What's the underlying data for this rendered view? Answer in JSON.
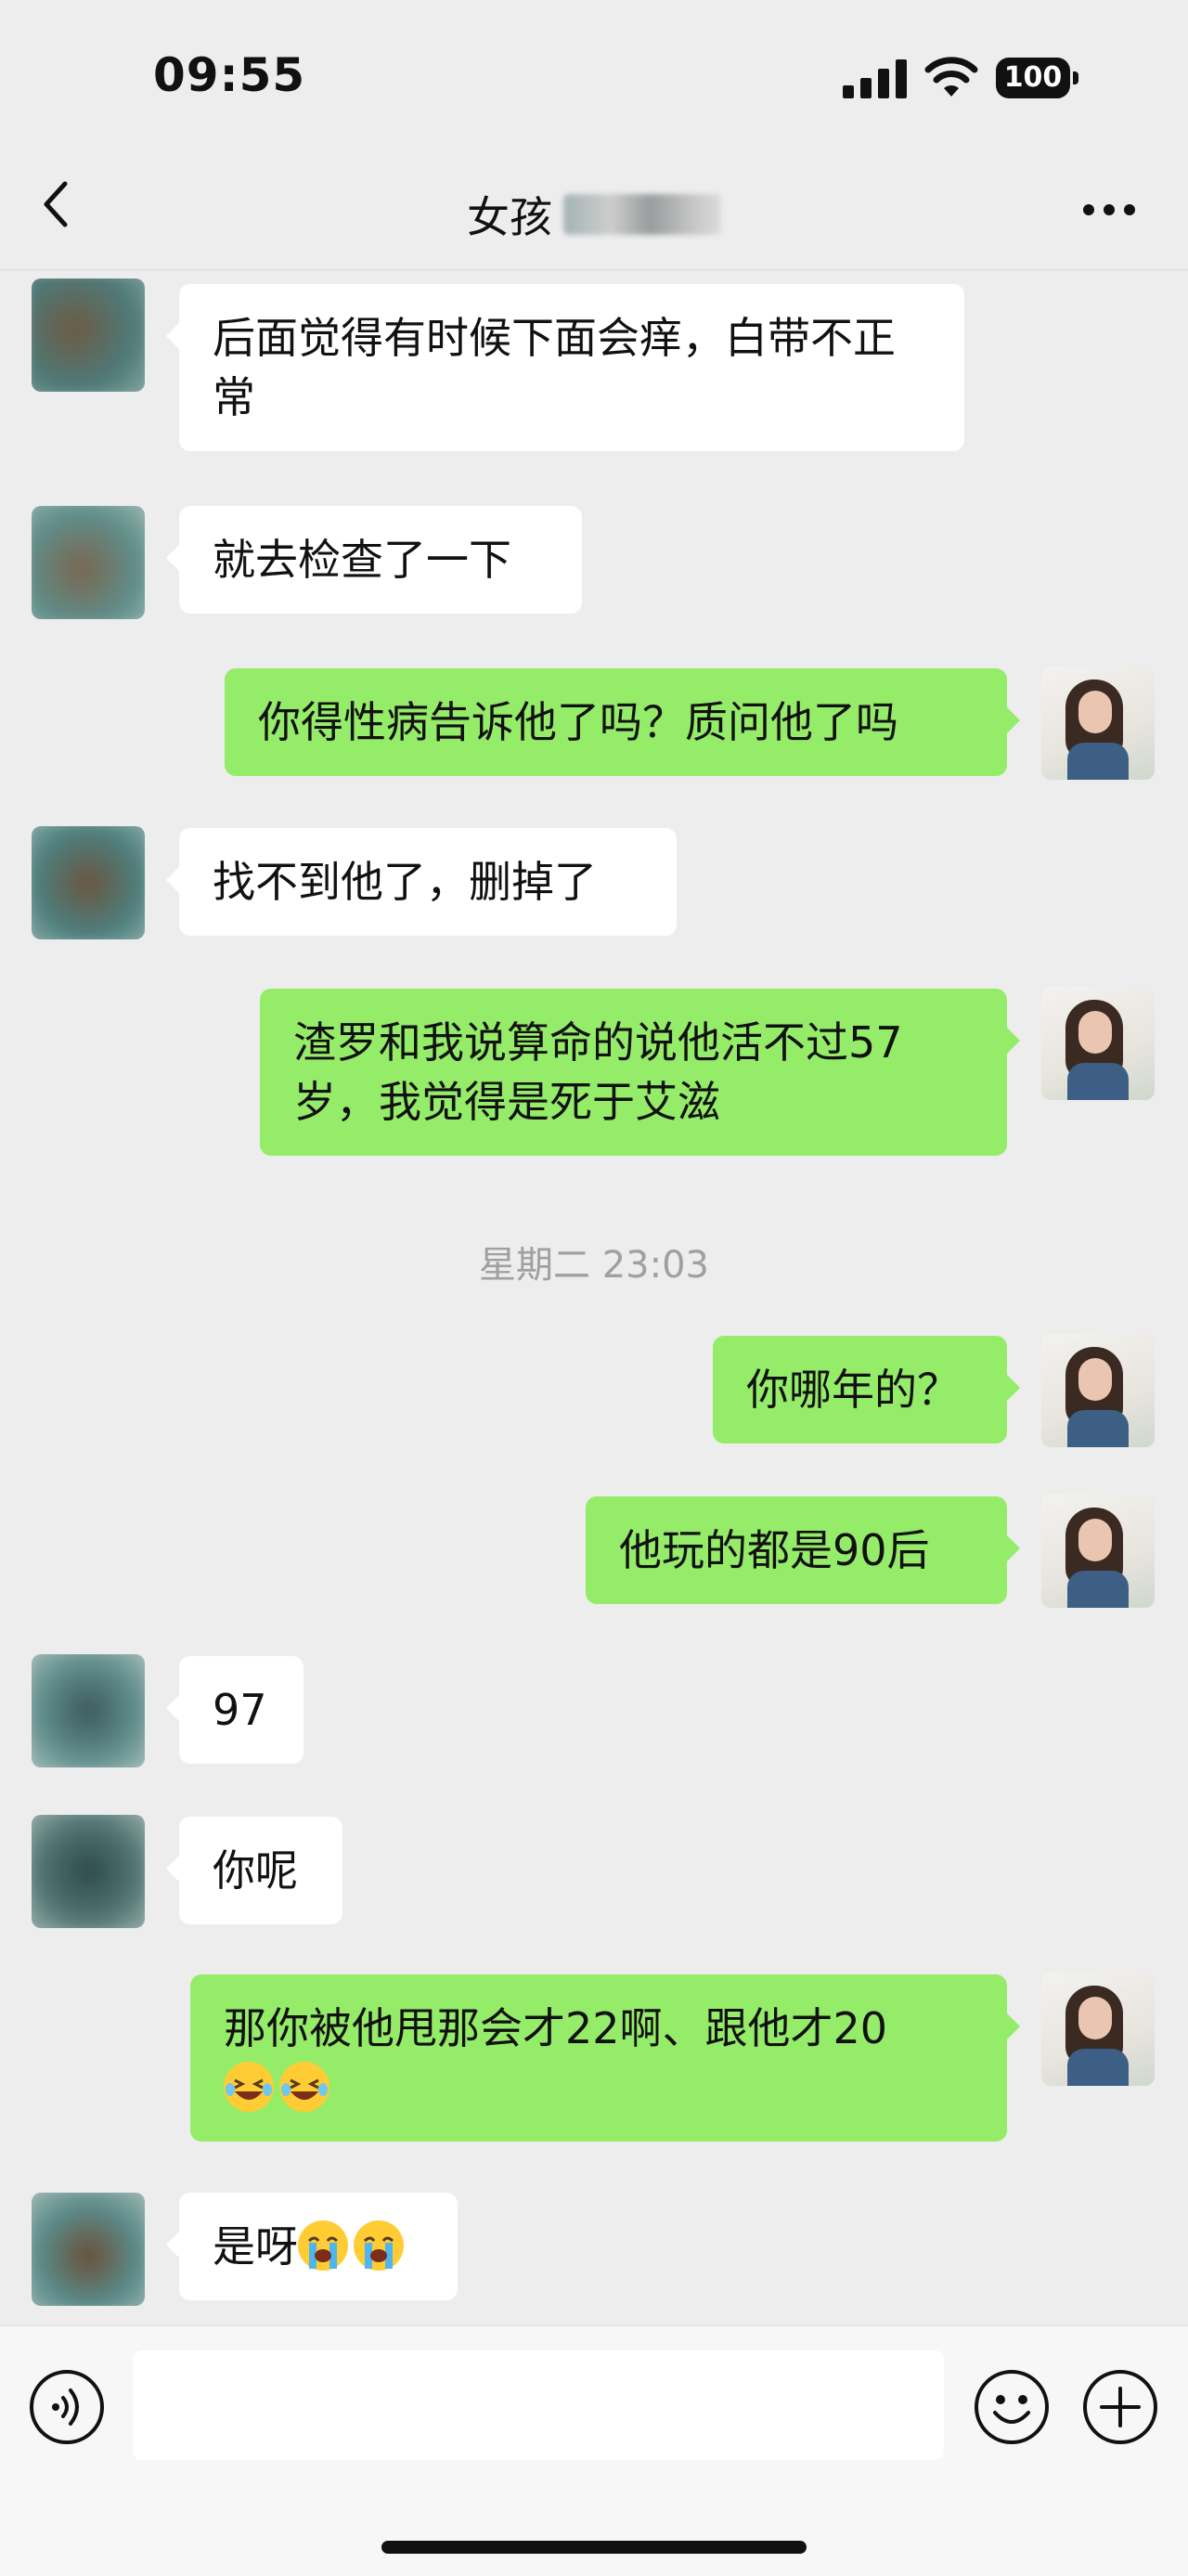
{
  "status_bar": {
    "time": "09:55",
    "battery": "100"
  },
  "nav": {
    "title": "女孩",
    "back_icon": "chevron-left-icon",
    "more_icon": "more-dots-icon"
  },
  "messages": [
    {
      "side": "in",
      "text": "后面觉得有时候下面会痒，白带不正常"
    },
    {
      "side": "in",
      "text": "就去检查了一下"
    },
    {
      "side": "out",
      "text": "你得性病告诉他了吗？质问他了吗"
    },
    {
      "side": "in",
      "text": "找不到他了，删掉了"
    },
    {
      "side": "out",
      "text": "渣罗和我说算命的说他活不过57岁，我觉得是死于艾滋"
    },
    {
      "side": "out",
      "text": "你哪年的？"
    },
    {
      "side": "out",
      "text": "他玩的都是90后"
    },
    {
      "side": "in",
      "text": "97"
    },
    {
      "side": "in",
      "text": "你呢"
    },
    {
      "side": "out",
      "text": "那你被他甩那会才22啊、跟他才20"
    },
    {
      "side": "in",
      "text": "是呀"
    }
  ],
  "timestamp": "星期二 23:03",
  "emojis": {
    "msg10": [
      "grin-squint-tears-icon",
      "grin-squint-tears-icon"
    ],
    "msg11": [
      "loudly-crying-icon",
      "loudly-crying-icon"
    ]
  },
  "input_bar": {
    "voice_icon": "voice-icon",
    "emoji_icon": "smiley-icon",
    "plus_icon": "plus-circle-icon"
  },
  "colors": {
    "outgoing_bubble": "#95ec69",
    "incoming_bubble": "#ffffff",
    "background": "#ededed"
  }
}
